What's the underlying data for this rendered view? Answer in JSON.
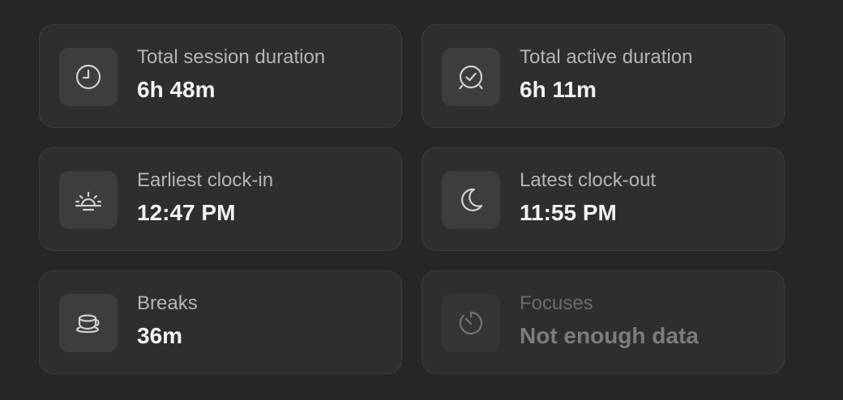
{
  "cards": [
    {
      "label": "Total session duration",
      "value": "6h 48m",
      "icon": "clock-icon",
      "enabled": true
    },
    {
      "label": "Total active duration",
      "value": "6h 11m",
      "icon": "alarm-clock-icon",
      "enabled": true
    },
    {
      "label": "Earliest clock-in",
      "value": "12:47 PM",
      "icon": "sunrise-icon",
      "enabled": true
    },
    {
      "label": "Latest clock-out",
      "value": "11:55 PM",
      "icon": "moon-icon",
      "enabled": true
    },
    {
      "label": "Breaks",
      "value": "36m",
      "icon": "coffee-cup-icon",
      "enabled": true
    },
    {
      "label": "Focuses",
      "value": "Not enough data",
      "icon": "timer-icon",
      "enabled": false
    }
  ],
  "colors": {
    "background": "#262624",
    "card": "#2e2e2c",
    "icon_box": "#3d3d3b",
    "label": "#b4b4b0",
    "value": "#f2f2f0",
    "disabled_text": "#6a6a67"
  }
}
